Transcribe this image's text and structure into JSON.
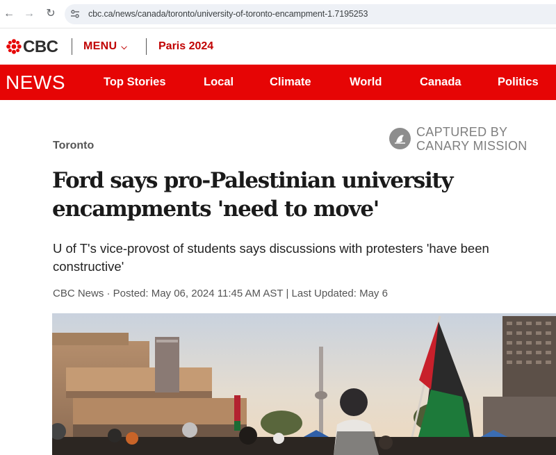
{
  "browser": {
    "url": "cbc.ca/news/canada/toronto/university-of-toronto-encampment-1.7195253",
    "back_icon": "arrow-left-icon",
    "forward_icon": "arrow-right-icon",
    "reload_icon": "reload-icon"
  },
  "header": {
    "logo_text": "CBC",
    "menu_label": "MENU",
    "paris_label": "Paris 2024",
    "accent_color": "#e60505"
  },
  "news_nav": {
    "label": "NEWS",
    "items": [
      "Top Stories",
      "Local",
      "Climate",
      "World",
      "Canada",
      "Politics"
    ]
  },
  "watermark": {
    "line1": "CAPTURED BY",
    "line2": "CANARY MISSION"
  },
  "article": {
    "section": "Toronto",
    "headline_line1": "Ford says pro-Palestinian university",
    "headline_line2": "encampments 'need to move'",
    "deck": "U of T's vice-provost of students says discussions with protesters 'have been constructive'",
    "byline": "CBC News · Posted: May 06, 2024 11:45 AM AST | Last Updated: May 6"
  }
}
